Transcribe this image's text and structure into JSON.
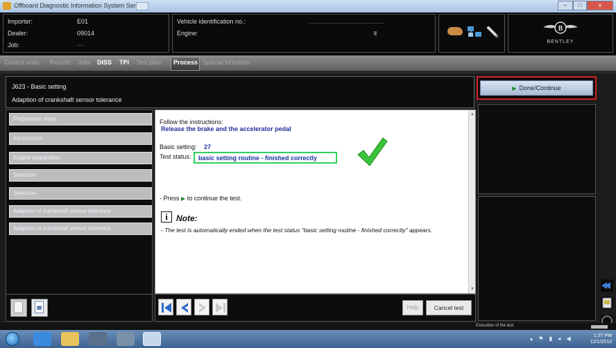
{
  "window": {
    "title": "Offboard Diagnostic Information System Service",
    "buttons": {
      "minimize": "–",
      "maximize": "□",
      "close": "x"
    }
  },
  "header": {
    "importer_label": "Importer:",
    "importer_value": "E01",
    "dealer_label": "Dealer:",
    "dealer_value": "09014",
    "job_label": "Job:",
    "job_value": "---",
    "vin_label": "Vehicle identification no.:",
    "engine_label": "Engine:",
    "brand": "BENTLEY"
  },
  "tabs": [
    {
      "label": "Control units",
      "active": false
    },
    {
      "label": "Results",
      "active": false
    },
    {
      "label": "Jobs",
      "active": false
    },
    {
      "label": "DISS",
      "active": true
    },
    {
      "label": "TPI",
      "active": true
    },
    {
      "label": "Test plan",
      "active": false
    },
    {
      "label": "Process",
      "active": true
    },
    {
      "label": "Special functions",
      "active": false
    }
  ],
  "title_block": {
    "line1": "J623 - Basic setting",
    "line2": "Adaption of crankshaft sensor tolerance"
  },
  "right_panel": {
    "done_label": "Done/Continue"
  },
  "steps": [
    "Preparation steps",
    "Introduction",
    "Engine preparation",
    "Selection",
    "Selection",
    "Adaption of crankshaft sensor tolerance",
    "Adaption of crankshaft sensor tolerance"
  ],
  "content": {
    "follow_label": "Follow the instructions:",
    "instruction": "Release the brake and the accelerator pedal",
    "basic_setting_label": "Basic setting:",
    "basic_setting_value": "27",
    "test_status_label": "Test status:",
    "test_status_value": "basic setting routine - finished correctly",
    "press_prefix": "- Press",
    "press_suffix": "to continue the test.",
    "note_title": "Note:",
    "note_text": "- The test is automatically ended when the test status \"basic setting routine - finished correctly\" appears."
  },
  "bottom_bar": {
    "help_label": "Help",
    "cancel_label": "Cancel test"
  },
  "status_strip": {
    "message": "Execution of the test"
  },
  "taskbar": {
    "time": "1:37 PM",
    "date": "12/1/2013"
  },
  "colors": {
    "accent_red": "#d62424",
    "status_green": "#2fcf5a",
    "text_blue": "#1f2f9c"
  }
}
